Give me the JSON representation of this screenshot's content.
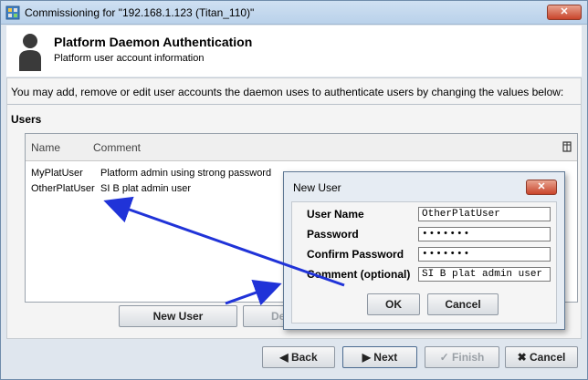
{
  "window": {
    "title": "Commissioning for \"192.168.1.123 (Titan_110)\"",
    "close_label": "✕"
  },
  "header": {
    "title": "Platform Daemon Authentication",
    "subtitle": "Platform user account information"
  },
  "intro": "You may add, remove or edit user accounts the daemon uses to authenticate users by changing the values below:",
  "users": {
    "section_title": "Users",
    "columns": [
      "Name",
      "Comment"
    ],
    "rows": [
      {
        "name": "MyPlatUser",
        "comment": "Platform admin using strong password"
      },
      {
        "name": "OtherPlatUser",
        "comment": "SI B plat admin user"
      }
    ],
    "new_user_button": "New User",
    "delete_button_partial": "De"
  },
  "dialog": {
    "title": "New User",
    "close_label": "✕",
    "fields": {
      "user_name_label": "User Name",
      "user_name_value": "OtherPlatUser",
      "password_label": "Password",
      "password_value": "•••••••",
      "confirm_label": "Confirm Password",
      "confirm_value": "•••••••",
      "comment_label": "Comment (optional)",
      "comment_value": "SI B plat admin user"
    },
    "ok_label": "OK",
    "cancel_label": "Cancel"
  },
  "wizard": {
    "back_label": "Back",
    "next_label": "Next",
    "finish_label": "Finish",
    "cancel_label": "Cancel"
  },
  "colors": {
    "annotation_arrow": "#2033d8",
    "close_button": "#c9442b"
  }
}
